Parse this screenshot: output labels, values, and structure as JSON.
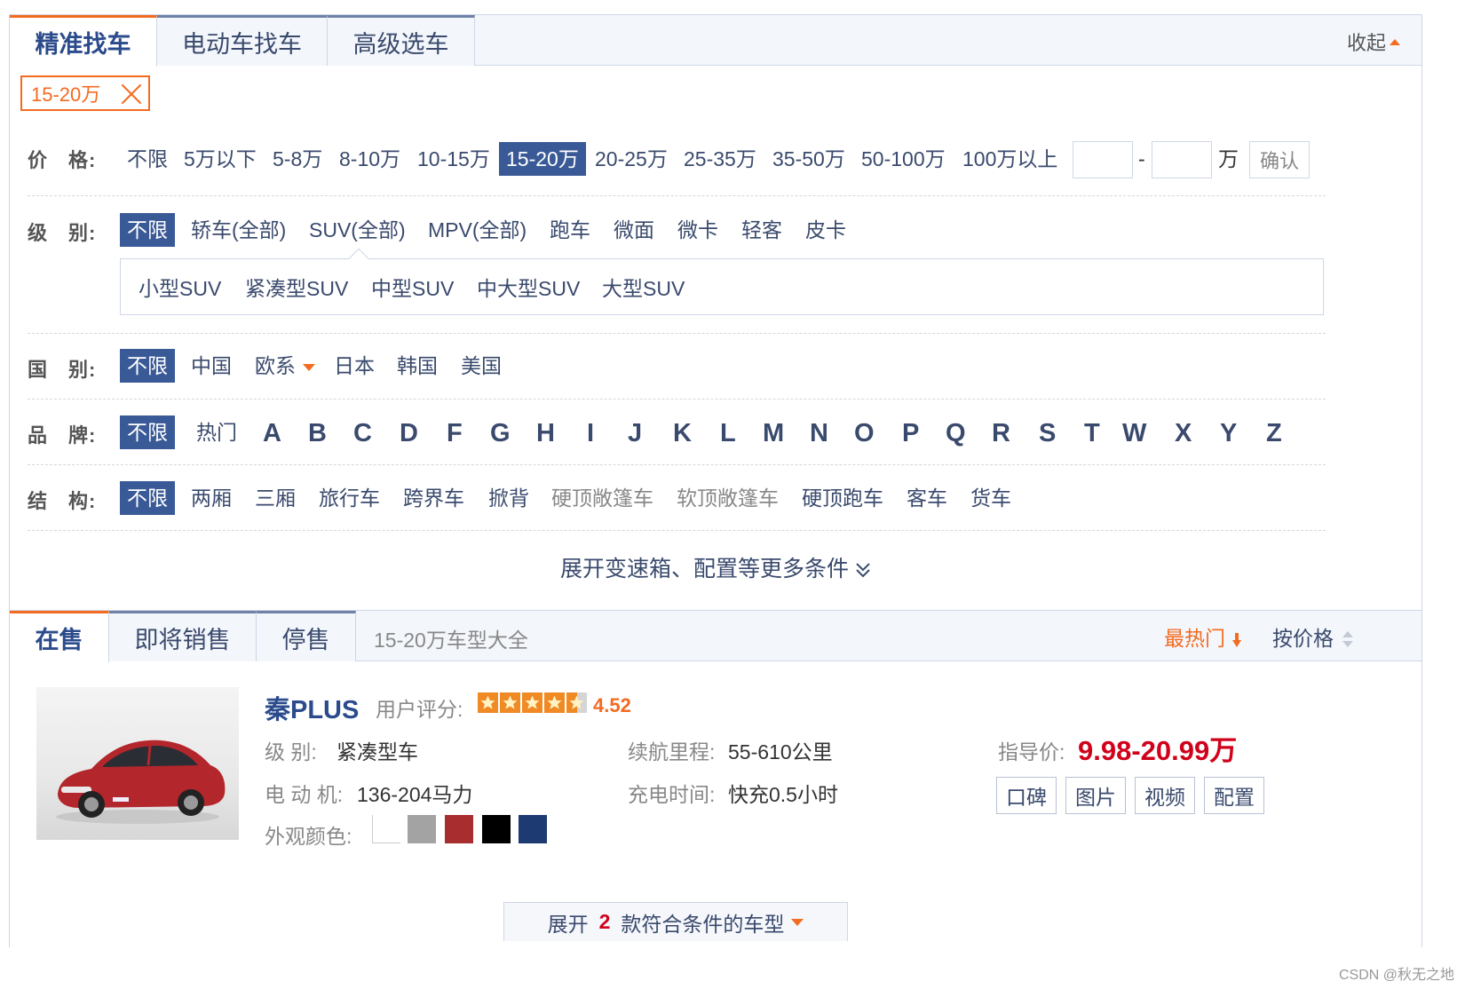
{
  "filter_tabs": [
    "精准找车",
    "电动车找车",
    "高级选车"
  ],
  "collapse_label": "收起",
  "selected_chip": "15-20万",
  "price": {
    "label": "价　格:",
    "options": [
      "不限",
      "5万以下",
      "5-8万",
      "8-10万",
      "10-15万",
      "15-20万",
      "20-25万",
      "25-35万",
      "35-50万",
      "50-100万",
      "100万以上"
    ],
    "selected": "15-20万",
    "range_separator": "-",
    "unit": "万",
    "confirm": "确认"
  },
  "level": {
    "label": "级　别:",
    "options": [
      "不限",
      "轿车(全部)",
      "SUV(全部)",
      "MPV(全部)",
      "跑车",
      "微面",
      "微卡",
      "轻客",
      "皮卡"
    ],
    "selected": "不限",
    "suv_sub": [
      "小型SUV",
      "紧凑型SUV",
      "中型SUV",
      "中大型SUV",
      "大型SUV"
    ]
  },
  "country": {
    "label": "国　别:",
    "options": [
      "不限",
      "中国",
      "欧系",
      "日本",
      "韩国",
      "美国"
    ],
    "selected": "不限"
  },
  "brand": {
    "label": "品　牌:",
    "options": [
      "不限",
      "热门"
    ],
    "selected": "不限",
    "letters": [
      "A",
      "B",
      "C",
      "D",
      "F",
      "G",
      "H",
      "I",
      "J",
      "K",
      "L",
      "M",
      "N",
      "O",
      "P",
      "Q",
      "R",
      "S",
      "T",
      "W",
      "X",
      "Y",
      "Z"
    ]
  },
  "structure": {
    "label": "结　构:",
    "options": [
      "不限",
      "两厢",
      "三厢",
      "旅行车",
      "跨界车",
      "掀背",
      "硬顶敞篷车",
      "软顶敞篷车",
      "硬顶跑车",
      "客车",
      "货车"
    ],
    "selected": "不限"
  },
  "expand_more": "展开变速箱、配置等更多条件",
  "results": {
    "tabs": [
      "在售",
      "即将销售",
      "停售"
    ],
    "title": "15-20万车型大全",
    "sort_hot": "最热门",
    "sort_price": "按价格",
    "car": {
      "name": "秦PLUS",
      "rating_label": "用户评分:",
      "rating": 4.52,
      "rating_text": "4.52",
      "level_label": "级  别:",
      "level": "紧凑型车",
      "motor_label": "电 动 机:",
      "motor": "136-204马力",
      "colors_label": "外观颜色:",
      "colors": [
        "#ffffff",
        "#a3a3a3",
        "#a82d2f",
        "#000000",
        "#1d3a73"
      ],
      "range_label": "续航里程:",
      "range": "55-610公里",
      "charge_label": "充电时间:",
      "charge": "快充0.5小时",
      "price_label": "指导价:",
      "price": "9.98-20.99万",
      "buttons": [
        "口碑",
        "图片",
        "视频",
        "配置"
      ]
    },
    "more_prefix": "展开",
    "more_count": "2",
    "more_suffix": "款符合条件的车型"
  },
  "watermark": "CSDN @秋无之地",
  "accent_color": "#f36b21",
  "selected_bg": "#3a5a97"
}
